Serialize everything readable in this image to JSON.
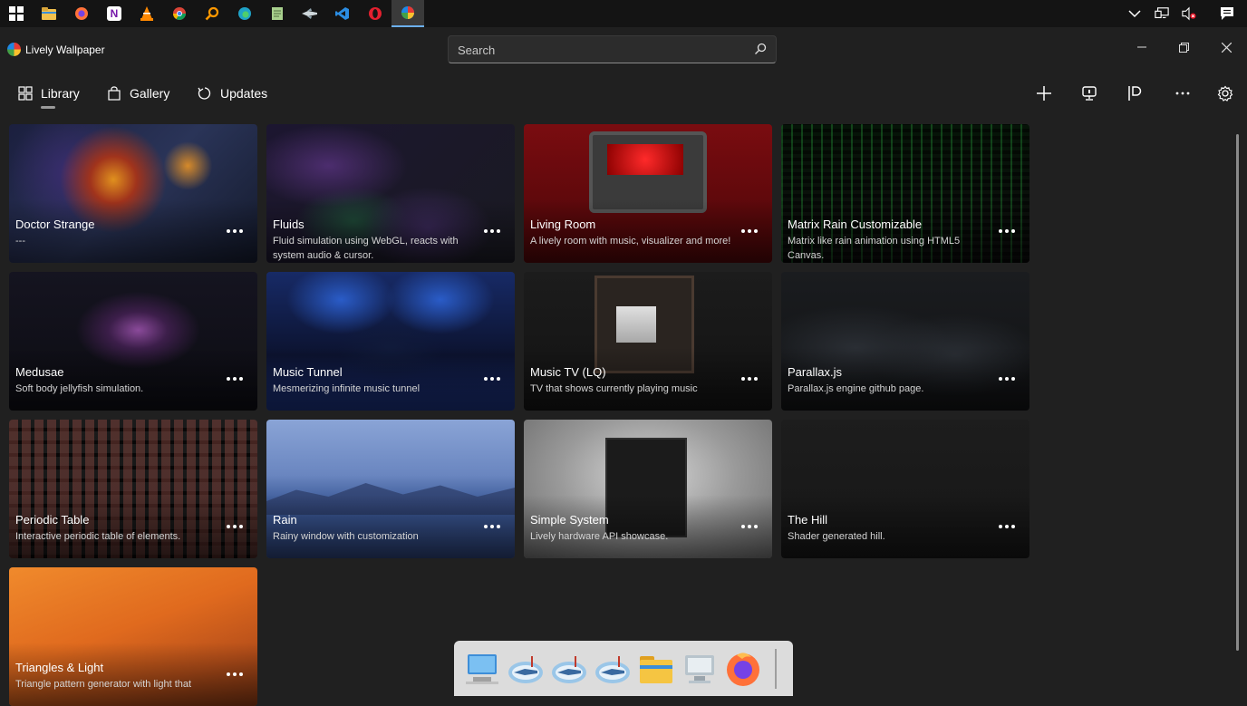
{
  "taskbar": {
    "apps": [
      {
        "icon": "windows-start-icon",
        "color": "#ffffff"
      },
      {
        "icon": "file-explorer-icon",
        "color": "#f2c14e"
      },
      {
        "icon": "firefox-icon",
        "color": "#ff7139"
      },
      {
        "icon": "onenote-icon",
        "color": "#7719aa"
      },
      {
        "icon": "vlc-icon",
        "color": "#ff8800"
      },
      {
        "icon": "chrome-icon",
        "color": "#db4437"
      },
      {
        "icon": "search-app-icon",
        "color": "#ff9800"
      },
      {
        "icon": "edge-icon",
        "color": "#1fa3c8"
      },
      {
        "icon": "notepad-icon",
        "color": "#a8d08d"
      },
      {
        "icon": "fighter-jet-icon",
        "color": "#cfd8dc"
      },
      {
        "icon": "vscode-icon",
        "color": "#2b8de3"
      },
      {
        "icon": "opera-icon",
        "color": "#e3202f"
      },
      {
        "icon": "lively-wallpaper-icon",
        "color": "#ffffff"
      }
    ],
    "tray": [
      "chevron-up-icon",
      "network-icon",
      "volume-muted-icon",
      "notifications-icon"
    ]
  },
  "titlebar": {
    "title": "Lively Wallpaper",
    "search_placeholder": "Search"
  },
  "nav": {
    "library": "Library",
    "gallery": "Gallery",
    "updates": "Updates"
  },
  "toolbar": [
    "add-icon",
    "display-icon",
    "customize-icon",
    "more-icon",
    "settings-icon"
  ],
  "wallpapers": [
    {
      "title": "Doctor Strange",
      "desc": "---"
    },
    {
      "title": "Fluids",
      "desc": "Fluid simulation using WebGL, reacts with system audio & cursor."
    },
    {
      "title": "Living Room",
      "desc": "A lively room with music, visualizer and more!"
    },
    {
      "title": "Matrix Rain Customizable",
      "desc": "Matrix like rain animation using HTML5 Canvas."
    },
    {
      "title": "Medusae",
      "desc": "Soft body jellyfish simulation."
    },
    {
      "title": "Music Tunnel",
      "desc": "Mesmerizing infinite music tunnel"
    },
    {
      "title": "Music TV (LQ)",
      "desc": "TV that shows currently playing music"
    },
    {
      "title": "Parallax.js",
      "desc": "Parallax.js engine github page."
    },
    {
      "title": "Periodic Table",
      "desc": "Interactive periodic table of elements."
    },
    {
      "title": "Rain",
      "desc": "Rainy window with customization"
    },
    {
      "title": "Simple System",
      "desc": "Lively hardware API showcase."
    },
    {
      "title": "The Hill",
      "desc": "Shader generated hill."
    },
    {
      "title": "Triangles & Light",
      "desc": "Triangle pattern generator with light that"
    }
  ],
  "dock": [
    "computer-icon",
    "jet-icon",
    "jet-icon",
    "jet-icon",
    "folder-icon",
    "computer-icon",
    "firefox-icon"
  ]
}
